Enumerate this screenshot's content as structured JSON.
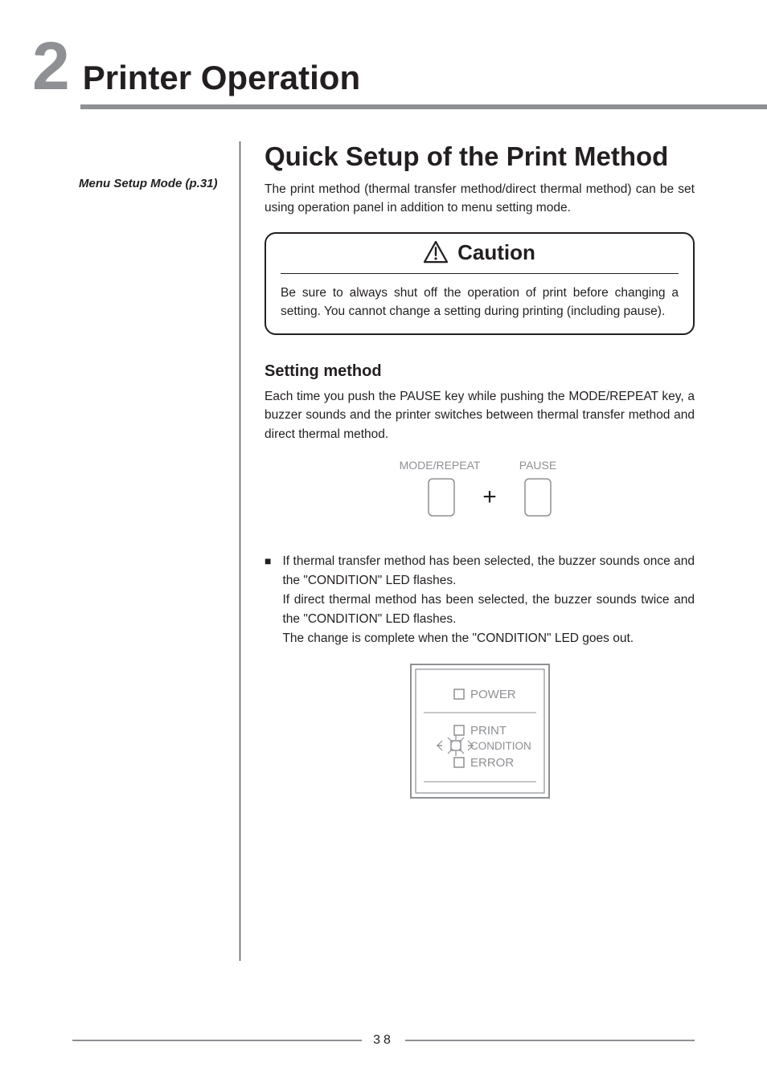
{
  "chapter": {
    "number": "2",
    "title": "Printer Operation"
  },
  "sidebar": {
    "note": "Menu Setup Mode (p.31)"
  },
  "section": {
    "title": "Quick Setup of the Print Method",
    "intro": "The print method (thermal transfer method/direct thermal method) can be set using operation panel in addition to menu setting mode."
  },
  "caution": {
    "title": "Caution",
    "body": "Be sure to always shut off the operation of print before changing a setting. You cannot change a setting during printing (including pause)."
  },
  "setting": {
    "title": "Setting method",
    "intro": "Each time you push the PAUSE key while pushing the MODE/REPEAT key, a buzzer sounds and the printer switches between thermal transfer method and direct thermal method."
  },
  "keys": {
    "left_label": "MODE/REPEAT",
    "right_label": "PAUSE",
    "plus": "+"
  },
  "bullet": {
    "p1": "If thermal transfer method has been selected, the buzzer sounds once and the \"CONDITION\" LED flashes.",
    "p2": "If direct thermal method has been selected, the buzzer sounds twice and the \"CONDITION\" LED flashes.",
    "p3": "The change is complete when the \"CONDITION\" LED goes out."
  },
  "leds": {
    "power": "POWER",
    "print": "PRINT",
    "condition": "CONDITION",
    "error": "ERROR"
  },
  "page_number": "38"
}
